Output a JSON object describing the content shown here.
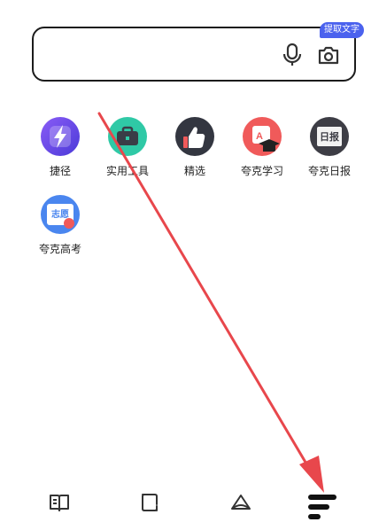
{
  "search": {
    "value": "",
    "placeholder": "",
    "ocr_badge_label": "提取文字",
    "mic_icon": "microphone-icon",
    "camera_icon": "camera-icon"
  },
  "apps": [
    {
      "label": "捷径",
      "icon": "lightning-icon",
      "color": "#6a4cf0"
    },
    {
      "label": "实用工具",
      "icon": "toolbox-icon",
      "color": "#2fc9a6"
    },
    {
      "label": "精选",
      "icon": "thumbs-up-icon",
      "color": "#333640"
    },
    {
      "label": "夸克学习",
      "icon": "graduation-cap-icon",
      "color": "#f05a5a"
    },
    {
      "label": "夸克日报",
      "icon": "newspaper-icon",
      "color": "#3d3d45"
    },
    {
      "label": "夸克高考",
      "icon": "volunteer-card-icon",
      "color": "#4a86ef"
    }
  ],
  "volunteer_card_text": "志愿",
  "newspaper_text": "日报",
  "bottom_nav": [
    {
      "icon": "book-icon"
    },
    {
      "icon": "tabs-icon"
    },
    {
      "icon": "cloud-icon"
    },
    {
      "icon": "menu-icon"
    }
  ],
  "accent_colors": {
    "arrow": "#e8474c",
    "badge": "#4b62ee"
  }
}
